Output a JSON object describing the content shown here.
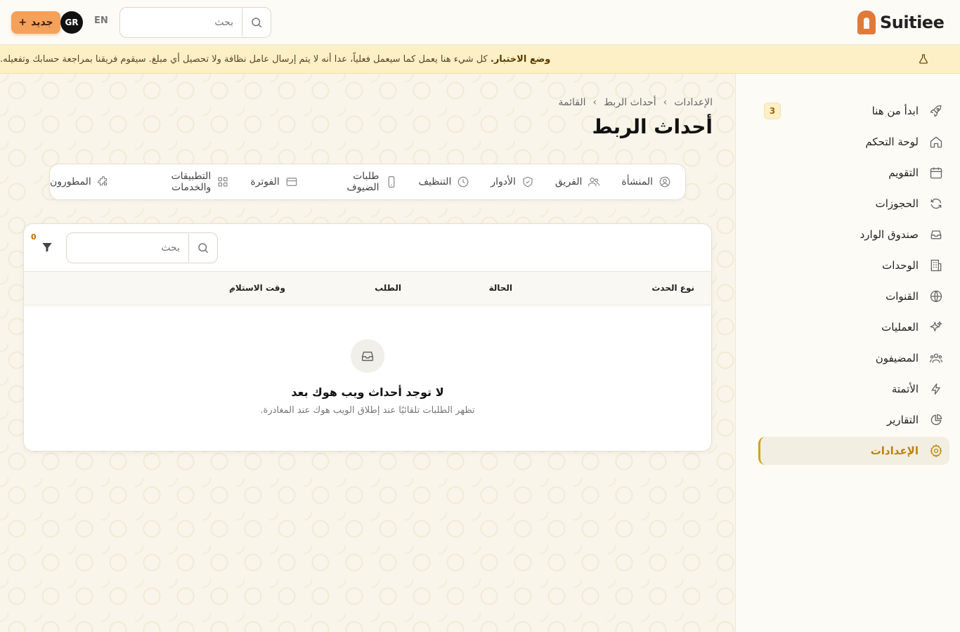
{
  "header": {
    "new_button_label": "جديد",
    "new_button_plus": "+",
    "avatar_initials": "GR",
    "language": "EN",
    "search_placeholder": "بحث",
    "brand_name": "Suitiee"
  },
  "banner": {
    "title": "وضع الاختبار.",
    "message": "كل شيء هنا يعمل كما سيعمل فعلياً، عدا أنه لا يتم إرسال عامل نظافة ولا تحصيل أي مبلغ. سيقوم فريقنا بمراجعة حسابك وتفعيله."
  },
  "breadcrumb": {
    "items": [
      "الإعدادات",
      "أحداث الربط",
      "القائمة"
    ],
    "separator": "›"
  },
  "page_title": "أحداث الربط",
  "tabs": [
    {
      "label": "المنشأة",
      "icon": "user-circle-icon"
    },
    {
      "label": "الفريق",
      "icon": "users-icon"
    },
    {
      "label": "الأدوار",
      "icon": "shield-check-icon"
    },
    {
      "label": "التنظيف",
      "icon": "clock-icon"
    },
    {
      "label": "طلبات الضيوف",
      "icon": "phone-icon"
    },
    {
      "label": "الفوترة",
      "icon": "credit-card-icon"
    },
    {
      "label": "التطبيقات والخدمات",
      "icon": "grid-icon"
    },
    {
      "label": "المطورون",
      "icon": "puzzle-icon"
    }
  ],
  "table": {
    "search_placeholder": "بحث",
    "filter_count": "0",
    "columns": [
      "نوع الحدث",
      "الحالة",
      "الطلب",
      "وقت الاستلام"
    ],
    "empty_title": "لا توجد أحداث ويب هوك بعد",
    "empty_subtitle": "تظهر الطلبات تلقائيًا عند إطلاق الويب هوك عند المغادرة."
  },
  "sidebar": {
    "items": [
      {
        "label": "ابدأ من هنا",
        "icon": "rocket-icon",
        "badge": "3"
      },
      {
        "label": "لوحة التحكم",
        "icon": "home-icon"
      },
      {
        "label": "التقويم",
        "icon": "calendar-icon"
      },
      {
        "label": "الحجوزات",
        "icon": "refresh-icon"
      },
      {
        "label": "صندوق الوارد",
        "icon": "inbox-icon"
      },
      {
        "label": "الوحدات",
        "icon": "building-icon"
      },
      {
        "label": "القنوات",
        "icon": "globe-icon"
      },
      {
        "label": "العمليات",
        "icon": "sparkles-icon"
      },
      {
        "label": "المضيفون",
        "icon": "users-icon"
      },
      {
        "label": "الأتمتة",
        "icon": "bolt-icon"
      },
      {
        "label": "التقارير",
        "icon": "pie-chart-icon"
      },
      {
        "label": "الإعدادات",
        "icon": "gear-icon",
        "active": true
      }
    ]
  },
  "colors": {
    "accent": "#d4a017",
    "new_button": "#f4a15c",
    "banner_bg": "#fdf0c7",
    "brand": "#e07a3a"
  }
}
